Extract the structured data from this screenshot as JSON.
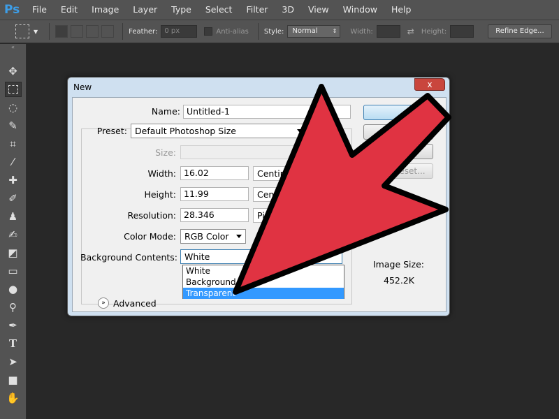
{
  "app": {
    "logo": "Ps"
  },
  "menu": [
    "File",
    "Edit",
    "Image",
    "Layer",
    "Type",
    "Select",
    "Filter",
    "3D",
    "View",
    "Window",
    "Help"
  ],
  "options": {
    "feather_label": "Feather:",
    "feather_value": "0 px",
    "antialias_label": "Anti-alias",
    "style_label": "Style:",
    "style_value": "Normal",
    "width_label": "Width:",
    "height_label": "Height:",
    "refine_edge": "Refine Edge..."
  },
  "dialog": {
    "title": "New",
    "close": "x",
    "name_label": "Name:",
    "name_value": "Untitled-1",
    "preset_label": "Preset:",
    "preset_value": "Default Photoshop Size",
    "size_label": "Size:",
    "width_label": "Width:",
    "width_value": "16.02",
    "width_unit": "Centim",
    "height_label": "Height:",
    "height_value": "11.99",
    "height_unit": "Cent",
    "resolution_label": "Resolution:",
    "resolution_value": "28.346",
    "resolution_unit": "Pi",
    "color_mode_label": "Color Mode:",
    "color_mode_value": "RGB Color",
    "bg_label": "Background Contents:",
    "bg_value": "White",
    "bg_options": [
      "White",
      "Background C",
      "Transparent"
    ],
    "advanced_label": "Advanced",
    "reset_button": "eset...",
    "image_size_label": "Image Size:",
    "image_size_value": "452.2K"
  },
  "colors": {
    "arrow_fill": "#e03342",
    "selected_option": "#3399ff",
    "ps_blue": "#3d9ee8"
  }
}
